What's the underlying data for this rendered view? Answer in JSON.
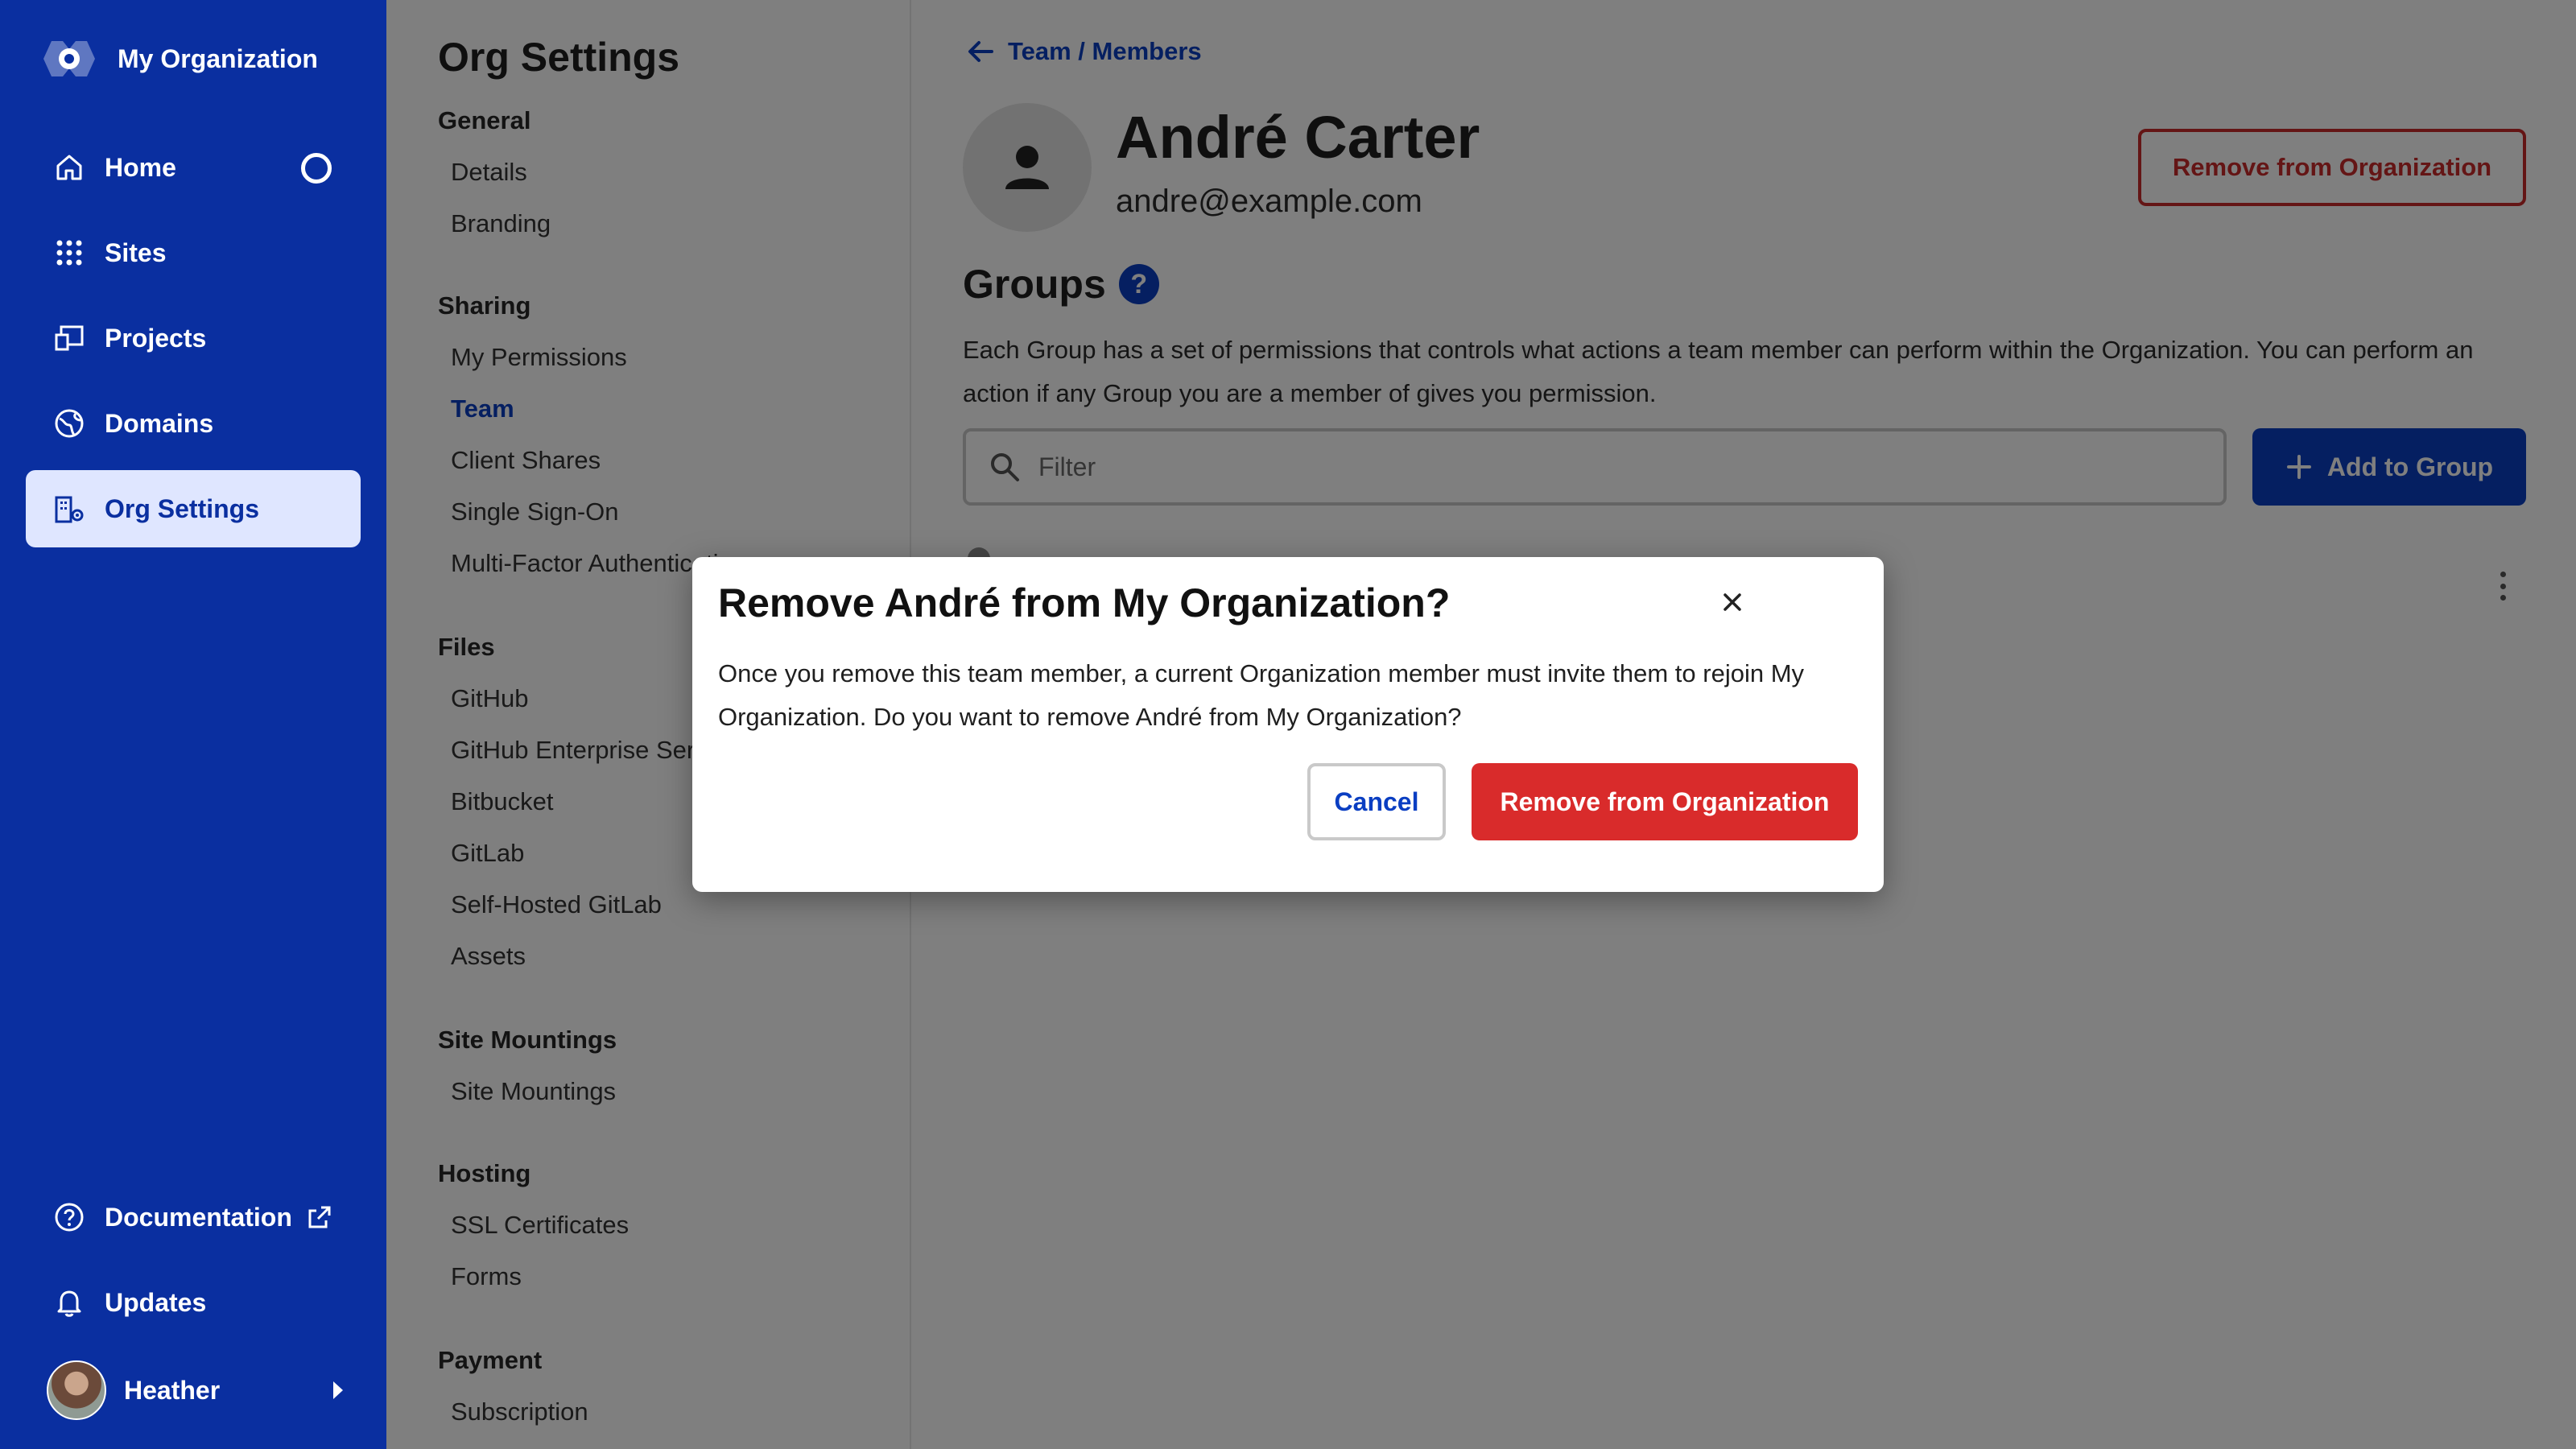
{
  "app": {
    "org_name": "My Organization",
    "logo_icon": "org-logo-icon"
  },
  "nav": {
    "items": [
      {
        "label": "Home",
        "icon": "home-icon"
      },
      {
        "label": "Sites",
        "icon": "grid-icon"
      },
      {
        "label": "Projects",
        "icon": "projects-icon"
      },
      {
        "label": "Domains",
        "icon": "globe-icon"
      },
      {
        "label": "Org Settings",
        "icon": "org-settings-icon",
        "active": true
      }
    ],
    "bottom": [
      {
        "label": "Documentation",
        "icon": "help-circle-icon"
      },
      {
        "label": "Updates",
        "icon": "bell-icon"
      }
    ],
    "user": {
      "name": "Heather"
    }
  },
  "settings": {
    "title": "Org Settings",
    "sections": [
      {
        "heading": "General",
        "items": [
          "Details",
          "Branding"
        ]
      },
      {
        "heading": "Sharing",
        "items": [
          "My Permissions",
          "Team",
          "Client Shares",
          "Single Sign-On",
          "Multi-Factor Authentication"
        ]
      },
      {
        "heading": "Files",
        "items": [
          "GitHub",
          "GitHub Enterprise Server",
          "Bitbucket",
          "GitLab",
          "Self-Hosted GitLab",
          "Assets"
        ]
      },
      {
        "heading": "Site Mountings",
        "items": [
          "Site Mountings"
        ]
      },
      {
        "heading": "Hosting",
        "items": [
          "SSL Certificates",
          "Forms"
        ]
      },
      {
        "heading": "Payment",
        "items": [
          "Subscription"
        ]
      }
    ],
    "active_item": "Team"
  },
  "main": {
    "breadcrumb": "Team / Members",
    "member": {
      "name": "André Carter",
      "email": "andre@example.com"
    },
    "remove_label": "Remove from Organization",
    "groups": {
      "title": "Groups",
      "help_glyph": "?",
      "description": "Each Group has a set of permissions that controls what actions a team member can perform within the Organization. You can perform an action if any Group you are a member of gives you permission.",
      "filter_placeholder": "Filter",
      "filter_value": "",
      "add_label": "Add to Group"
    }
  },
  "modal": {
    "title": "Remove André from My Organization?",
    "body": "Once you remove this team member, a current Organization member must invite them to rejoin My Organization. Do you want to remove André from My Organization?",
    "cancel_label": "Cancel",
    "confirm_label": "Remove from Organization"
  },
  "colors": {
    "nav_bg": "#0a2fa0",
    "nav_active_bg": "#dfe6ff",
    "accent": "#0a3ec2",
    "danger": "#d92b2b",
    "overlay": "rgba(0,0,0,0.5)"
  }
}
